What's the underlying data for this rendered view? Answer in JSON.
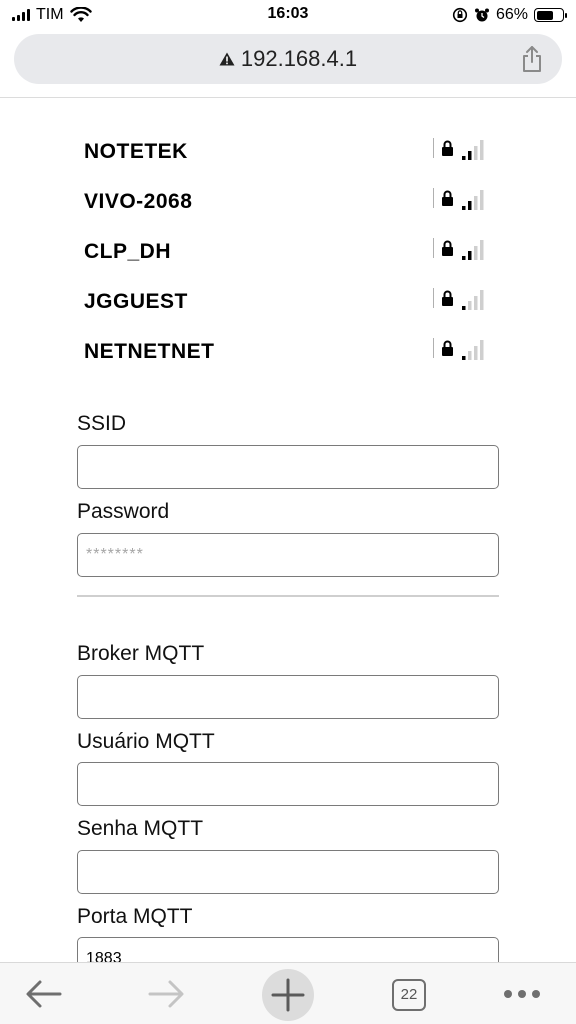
{
  "status_bar": {
    "carrier": "TIM",
    "time": "16:03",
    "battery_percent": "66%",
    "battery_level": 0.66
  },
  "address_bar": {
    "url": "192.168.4.1",
    "warning_icon": "warning-triangle-icon",
    "share_icon": "share-icon"
  },
  "networks": [
    {
      "ssid": "NOTETEK",
      "locked": true,
      "signal_bars": 2
    },
    {
      "ssid": "VIVO-2068",
      "locked": true,
      "signal_bars": 2
    },
    {
      "ssid": "CLP_DH",
      "locked": true,
      "signal_bars": 2
    },
    {
      "ssid": "JGGUEST",
      "locked": true,
      "signal_bars": 1
    },
    {
      "ssid": "NETNETNET",
      "locked": true,
      "signal_bars": 1
    }
  ],
  "form": {
    "ssid_label": "SSID",
    "ssid_value": "",
    "password_label": "Password",
    "password_placeholder": "********",
    "broker_label": "Broker MQTT",
    "broker_value": "",
    "usuario_label": "Usuário MQTT",
    "usuario_value": "",
    "senha_label": "Senha MQTT",
    "senha_value": "",
    "porta_label": "Porta MQTT",
    "porta_value": "1883"
  },
  "toolbar": {
    "tab_count": "22"
  }
}
